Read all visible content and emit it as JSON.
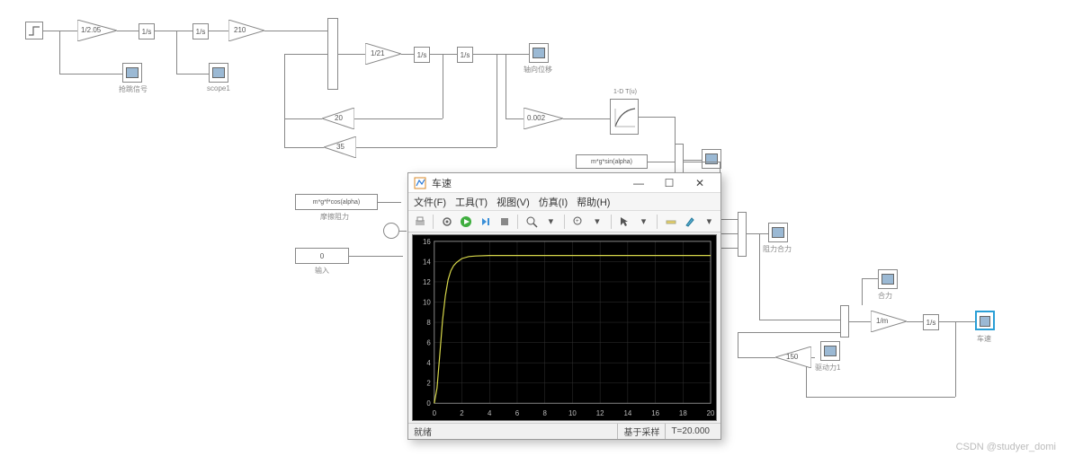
{
  "blocks": {
    "gain1": "1/2.05",
    "integ": "1/s",
    "gain210": "210",
    "gain1_21": "1/21",
    "gain20": "20",
    "gain35": "35",
    "gain0_002": "0.002",
    "gain150": "150",
    "gain1_m": "1/m",
    "const_friction": "m*g*f*cos(alpha)",
    "const_zero": "0",
    "grav_sin": "m*g*sin(alpha)"
  },
  "labels": {
    "scope_signal": "抢跳信号",
    "scope1": "scope1",
    "axle_disp": "轴向位移",
    "friction": "摩擦阻力",
    "input": "输入",
    "resist_sum": "阻力合力",
    "sum_force": "合力",
    "drive_force": "驱动力1",
    "speed": "车速"
  },
  "lookup": {
    "top": "1-D T(u)"
  },
  "scope_window": {
    "title": "车速",
    "menu": {
      "file": "文件(F)",
      "tools": "工具(T)",
      "view": "视图(V)",
      "sim": "仿真(I)",
      "help": "帮助(H)"
    },
    "status_left": "就绪",
    "status_mid": "基于采样",
    "status_right": "T=20.000"
  },
  "chart_data": {
    "type": "line",
    "title": "车速",
    "xlabel": "",
    "ylabel": "",
    "xlim": [
      0,
      20
    ],
    "ylim": [
      0,
      16
    ],
    "x_ticks": [
      0,
      2,
      4,
      6,
      8,
      10,
      12,
      14,
      16,
      18,
      20
    ],
    "y_ticks": [
      0,
      2,
      4,
      6,
      8,
      10,
      12,
      14,
      16
    ],
    "series": [
      {
        "name": "车速",
        "color": "#d8d84a",
        "x": [
          0,
          0.2,
          0.4,
          0.6,
          0.8,
          1.0,
          1.2,
          1.4,
          1.6,
          1.8,
          2.0,
          2.5,
          3,
          4,
          6,
          8,
          10,
          12,
          14,
          16,
          18,
          20
        ],
        "y": [
          0,
          1.5,
          4.8,
          8.2,
          10.6,
          12.2,
          13.1,
          13.6,
          13.9,
          14.1,
          14.3,
          14.5,
          14.55,
          14.6,
          14.6,
          14.6,
          14.6,
          14.6,
          14.6,
          14.6,
          14.6,
          14.6
        ]
      }
    ]
  },
  "watermark": "CSDN @studyer_domi"
}
